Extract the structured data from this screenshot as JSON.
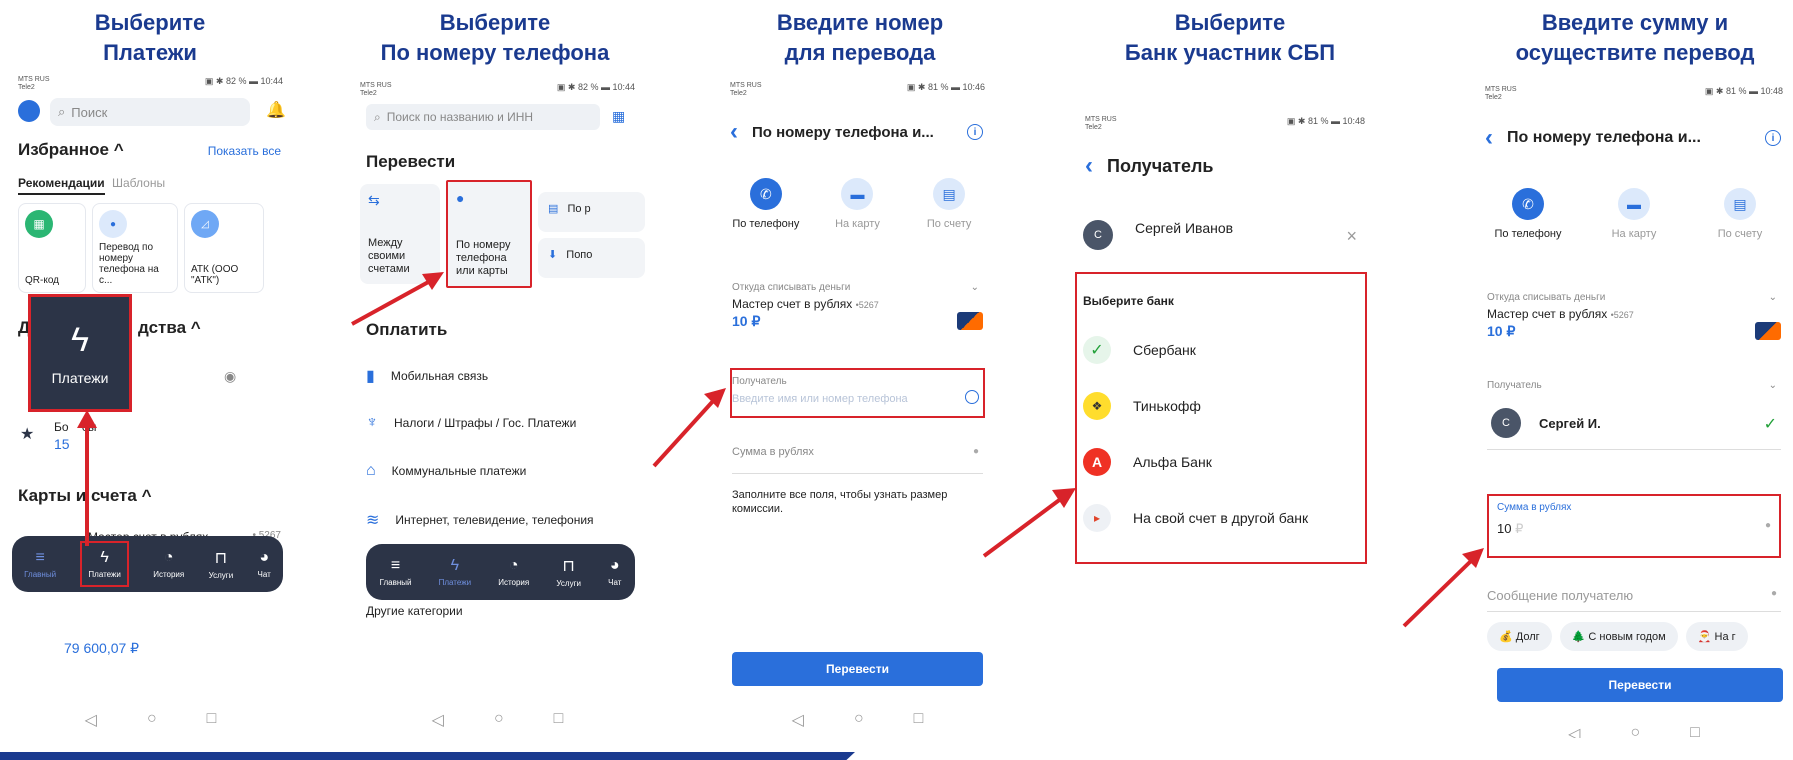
{
  "steps": [
    {
      "title1": "Выберите",
      "title2": "Платежи"
    },
    {
      "title1": "Выберите",
      "title2": "По номеру телефона"
    },
    {
      "title1": "Введите номер",
      "title2": "для перевода"
    },
    {
      "title1": "Выберите",
      "title2": "Банк участник СБП"
    },
    {
      "title1": "Введите сумму и",
      "title2": "осуществите перевод"
    }
  ],
  "screen1": {
    "time": "10:44",
    "battery": "82 %",
    "search_placeholder": "Поиск",
    "favorites_title": "Избранное",
    "show_all": "Показать все",
    "tab_recommend": "Рекомендации",
    "tab_templates": "Шаблоны",
    "tiles": [
      "QR-код",
      "Перевод по номеру телефона на с...",
      "АТК (ООО \"АТК\")"
    ],
    "section_partial_left": "Д",
    "section_partial_right": "дства",
    "payments_popup": "Платежи",
    "bonus_label_a": "Бо",
    "bonus_label_b": "сы",
    "bonus_value": "15",
    "cards_title": "Карты и счета",
    "card_name": "Мастер счет в рублях",
    "card_num": "• 5267",
    "card_balance_partial": "79 600,07 ₽",
    "nav": [
      "Главный",
      "Платежи",
      "История",
      "Услуги",
      "Чат"
    ]
  },
  "screen2": {
    "time": "10:44",
    "battery": "82 %",
    "search_placeholder": "Поиск по названию и ИНН",
    "transfer_title": "Перевести",
    "tile_between": "Между своими счетами",
    "tile_phone": "По номеру телефона или карты",
    "tile_partial_a": "По р",
    "tile_partial_b": "Попо",
    "pay_title": "Оплатить",
    "pay_items": [
      "Мобильная связь",
      "Налоги / Штрафы / Гос. Платежи",
      "Коммунальные платежи",
      "Интернет, телевидение, телефония"
    ],
    "other_categories": "Другие категории",
    "nav": [
      "Главный",
      "Платежи",
      "История",
      "Услуги",
      "Чат"
    ]
  },
  "screen3": {
    "time": "10:46",
    "battery": "81 %",
    "title": "По номеру телефона и...",
    "methods": [
      "По телефону",
      "На карту",
      "По счету"
    ],
    "from_label": "Откуда списывать деньги",
    "from_account": "Мастер счет в рублях",
    "from_num": "•5267",
    "from_amount": "10 ₽",
    "recipient_label": "Получатель",
    "recipient_placeholder": "Введите имя или номер телефона",
    "sum_label": "Сумма в рублях",
    "hint": "Заполните все поля, чтобы узнать размер комиссии.",
    "button": "Перевести"
  },
  "screen4": {
    "time": "10:48",
    "battery": "81 %",
    "title": "Получатель",
    "contact_initial": "С",
    "contact_name": "Сергей Иванов",
    "choose_bank": "Выберите банк",
    "banks": [
      "Сбербанк",
      "Тинькофф",
      "Альфа Банк",
      "На свой счет в другой банк"
    ]
  },
  "screen5": {
    "time": "10:48",
    "battery": "81 %",
    "title": "По номеру телефона и...",
    "methods": [
      "По телефону",
      "На карту",
      "По счету"
    ],
    "from_label": "Откуда списывать деньги",
    "from_account": "Мастер счет в рублях",
    "from_num": "•5267",
    "from_amount": "10 ₽",
    "recipient_label": "Получатель",
    "recipient_initial": "С",
    "recipient_name": "Сергей И.",
    "sum_label": "Сумма в рублях",
    "sum_value": "10",
    "sum_currency": "₽",
    "message_label": "Сообщение получателю",
    "chips": [
      "Долг",
      "С новым годом",
      "На г"
    ],
    "button": "Перевести"
  },
  "colors": {
    "accent": "#2a6fdb",
    "highlight": "#d8232a",
    "title": "#1a3a8f",
    "nav_bg": "#2c3447"
  }
}
